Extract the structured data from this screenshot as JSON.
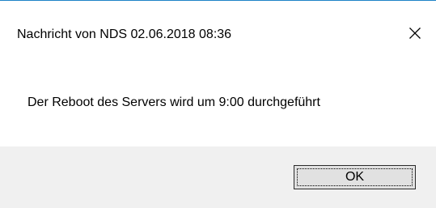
{
  "dialog": {
    "title": "Nachricht von NDS 02.06.2018 08:36",
    "message": "Der Reboot des Servers wird um 9:00 durchgeführt",
    "close_icon": "close-icon",
    "ok_label": "OK"
  },
  "colors": {
    "window_border": "#1e83c7",
    "background": "#ffffff",
    "footer_background": "#f0f0f0",
    "button_background": "#e1e1e1",
    "button_border": "#2b2b2b"
  }
}
